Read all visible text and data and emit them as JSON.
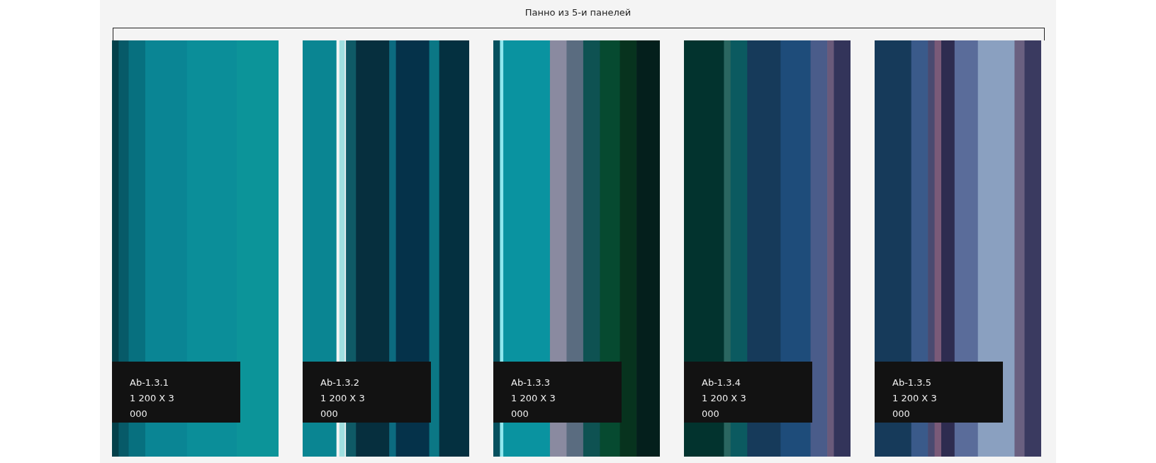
{
  "title": "Панно из 5-и панелей",
  "panels": [
    {
      "kind": "picture",
      "name": "Ab-1.3.1",
      "size": "1 200 X 3 000"
    },
    {
      "kind": "picture",
      "name": "Ab-1.3.2",
      "size": "1 200 X 3 000"
    },
    {
      "kind": "picture",
      "name": "Ab-1.3.3",
      "size": "1 200 X 3 000"
    },
    {
      "kind": "picture",
      "name": "Ab-1.3.4",
      "size": "1 200 X 3 000"
    },
    {
      "kind": "picture",
      "name": "Ab-1.3.5",
      "size": "1 200 X 3 000"
    }
  ]
}
